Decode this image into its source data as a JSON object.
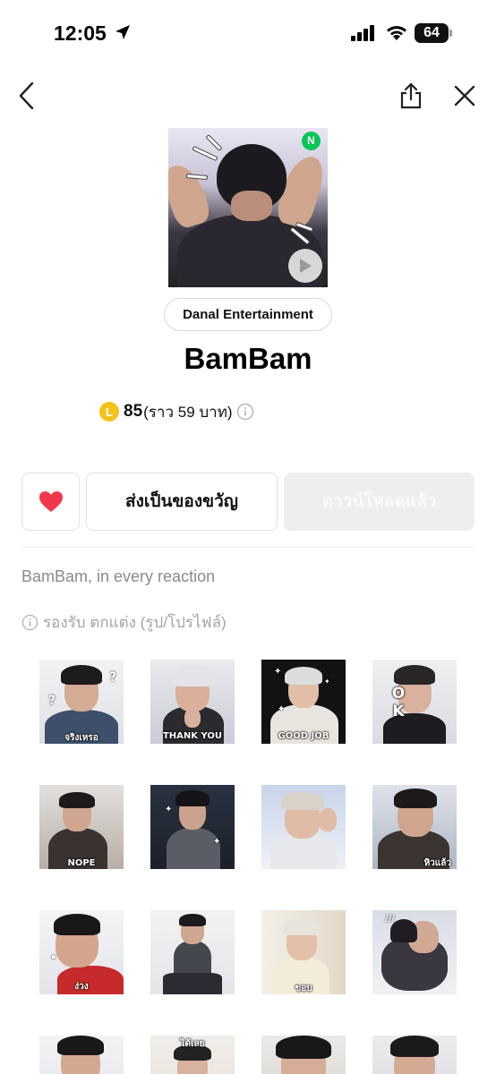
{
  "status_bar": {
    "time": "12:05",
    "battery_level": "64",
    "battery_percent": 64
  },
  "nav": {
    "back_icon": "chevron-left-icon",
    "share_icon": "share-icon",
    "close_icon": "close-icon"
  },
  "product": {
    "new_badge": "N",
    "author": "Danal Entertainment",
    "title": "BamBam",
    "coin_symbol": "L",
    "price": "85",
    "price_baht": "(ราว 59 บาท)",
    "description": "BamBam, in every reaction",
    "support_text": "รองรับ ตกแต่ง (รูป/โปรไฟล์)"
  },
  "actions": {
    "gift_label": "ส่งเป็นของขวัญ",
    "download_label": "ดาวน์โหลดแล้ว"
  },
  "colors": {
    "accent_green": "#06c755",
    "heart_red": "#f0384a",
    "coin_yellow": "#f5c21b"
  },
  "stickers": [
    {
      "caption": "จริงเหรอ"
    },
    {
      "caption": "THANK YOU"
    },
    {
      "caption": "GOOD JOB"
    },
    {
      "caption": "O K"
    },
    {
      "caption": "NOPE"
    },
    {
      "caption": ""
    },
    {
      "caption": ""
    },
    {
      "caption": "หิวแล้ว"
    },
    {
      "caption": "ง่วง"
    },
    {
      "caption": ""
    },
    {
      "caption": "ขอบ"
    },
    {
      "caption": ""
    },
    {
      "caption": ""
    },
    {
      "caption": "ได้เลย"
    },
    {
      "caption": ""
    },
    {
      "caption": ""
    }
  ]
}
